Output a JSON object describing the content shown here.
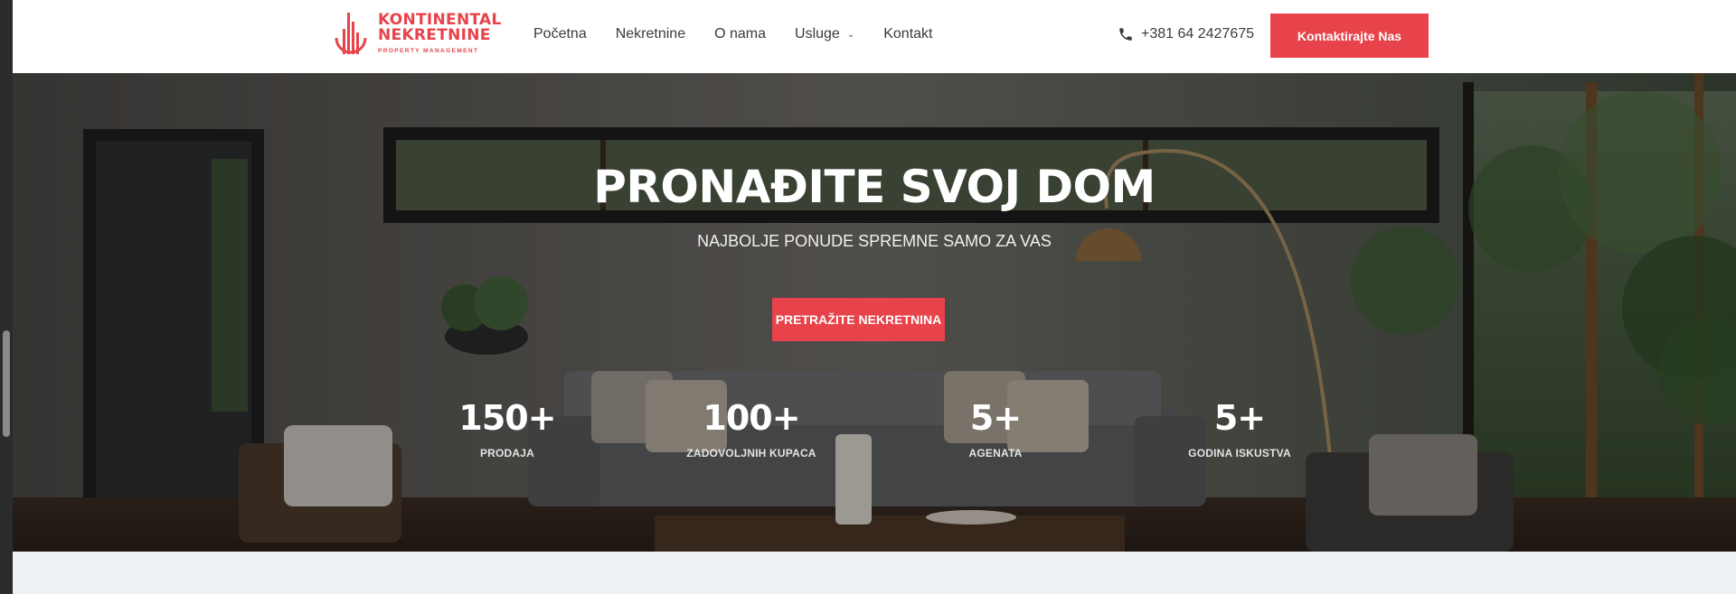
{
  "brand": {
    "line1": "KONTINENTAL",
    "line2": "NEKRETNINE",
    "tagline": "PROPERTY MANAGEMENT",
    "accent": "#e8434a"
  },
  "nav": {
    "items": [
      {
        "label": "Početna"
      },
      {
        "label": "Nekretnine"
      },
      {
        "label": "O nama"
      },
      {
        "label": "Usluge",
        "has_dropdown": true
      },
      {
        "label": "Kontakt"
      }
    ]
  },
  "header": {
    "phone": "+381 64 2427675",
    "cta_label": "Kontaktirajte Nas"
  },
  "hero": {
    "title": "PRONAĐITE SVOJ DOM",
    "subtitle": "NAJBOLJE PONUDE SPREMNE SAMO ZA VAS",
    "button_label": "PRETRAŽITE NEKRETNINA",
    "stats": [
      {
        "value": "150+",
        "label": "PRODAJA"
      },
      {
        "value": "100+",
        "label": "ZADOVOLJNIH KUPACA"
      },
      {
        "value": "5+",
        "label": "AGENATA"
      },
      {
        "value": "5+",
        "label": "GODINA ISKUSTVA"
      }
    ]
  }
}
